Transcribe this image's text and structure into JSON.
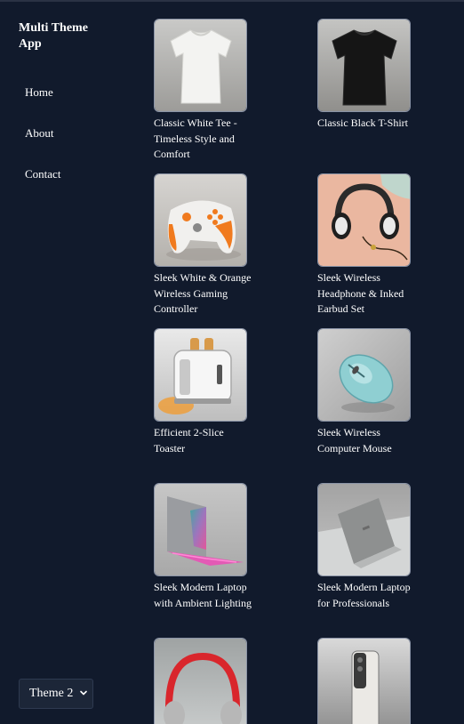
{
  "sidebar": {
    "brand": "Multi Theme App",
    "nav": [
      {
        "label": "Home"
      },
      {
        "label": "About"
      },
      {
        "label": "Contact"
      }
    ],
    "theme_select": {
      "value": "Theme 2"
    }
  },
  "products": [
    {
      "title": "Classic White Tee - Timeless Style and Comfort",
      "icon": "white-tshirt-image"
    },
    {
      "title": "Classic Black T-Shirt",
      "icon": "black-tshirt-image"
    },
    {
      "title": "Sleek White & Orange Wireless Gaming Controller",
      "icon": "game-controller-image"
    },
    {
      "title": "Sleek Wireless Headphone & Inked Earbud Set",
      "icon": "headphones-image"
    },
    {
      "title": "Efficient 2-Slice Toaster",
      "icon": "toaster-image"
    },
    {
      "title": "Sleek Wireless Computer Mouse",
      "icon": "computer-mouse-image"
    },
    {
      "title": "Sleek Modern Laptop with Ambient Lighting",
      "icon": "laptop-ambient-image"
    },
    {
      "title": "Sleek Modern Laptop for Professionals",
      "icon": "laptop-professional-image"
    },
    {
      "title": "",
      "icon": "red-headphones-image"
    },
    {
      "title": "",
      "icon": "smartphone-image"
    }
  ]
}
